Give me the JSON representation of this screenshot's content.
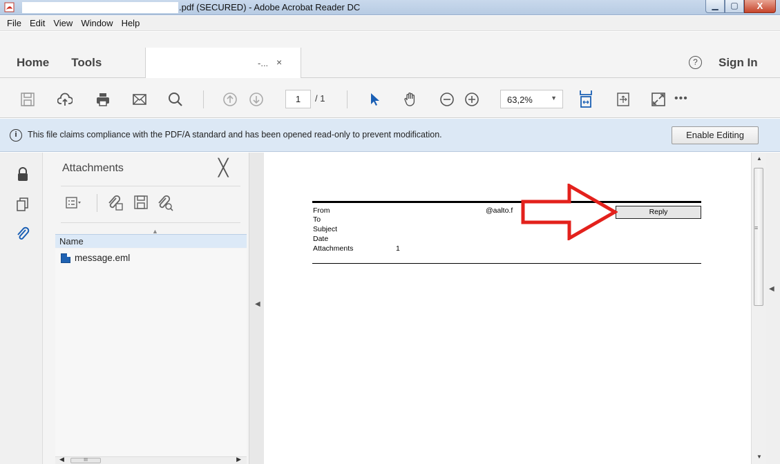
{
  "window": {
    "title": ".pdf (SECURED) - Adobe Acrobat Reader DC",
    "controls": {
      "minimize": "▁",
      "maximize": "▢",
      "close": "X"
    }
  },
  "menu": [
    {
      "label": "File"
    },
    {
      "label": "Edit"
    },
    {
      "label": "View"
    },
    {
      "label": "Window"
    },
    {
      "label": "Help"
    }
  ],
  "tabs": {
    "home": "Home",
    "tools": "Tools",
    "document_suffix": "-...",
    "document_close": "×",
    "help": "?",
    "sign_in": "Sign In"
  },
  "toolbar": {
    "page_current": "1",
    "page_total": "/ 1",
    "zoom": "63,2%",
    "more": "•••",
    "icons": [
      "save-icon",
      "upload-cloud-icon",
      "print-icon",
      "email-icon",
      "search-icon",
      "prev-page-icon",
      "next-page-icon",
      "select-cursor-icon",
      "hand-tool-icon",
      "zoom-out-icon",
      "zoom-in-icon",
      "fit-width-icon",
      "rotate-icon",
      "full-screen-icon"
    ]
  },
  "infobar": {
    "icon": "i",
    "message": "This file claims compliance with the PDF/A standard and has been opened read-only to prevent modification.",
    "button": "Enable Editing"
  },
  "attachments": {
    "title": "Attachments",
    "close": "╳",
    "column_name": "Name",
    "files": [
      "message.eml"
    ],
    "scroll_thumb": "III"
  },
  "document": {
    "fields": [
      {
        "label": "From",
        "value": "@aalto.f"
      },
      {
        "label": "To",
        "value": ""
      },
      {
        "label": "Subject",
        "value": ""
      },
      {
        "label": "Date",
        "value": ""
      },
      {
        "label": "Attachments",
        "value": "1"
      }
    ],
    "reply_button": "Reply",
    "annotation_color": "#e3211c"
  }
}
